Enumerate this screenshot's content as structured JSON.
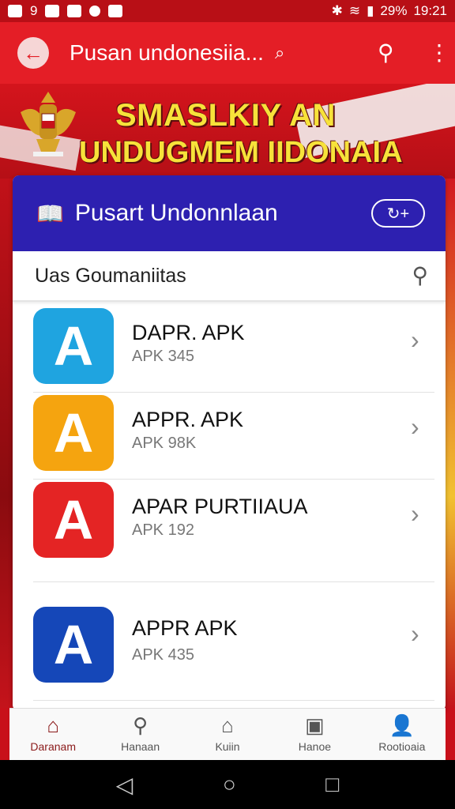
{
  "status_bar": {
    "left_icons": [
      "notification-icon",
      "sim-icon",
      "mail-icon",
      "dot-icon",
      "notification-icon"
    ],
    "left_text": "9",
    "battery": "29%",
    "time": "19:21"
  },
  "appbar": {
    "title": "Pusan undonesiia...",
    "search_glyph": "⌕",
    "back_glyph": "←",
    "search_action_glyph": "⚲",
    "menu_glyph": "⋮"
  },
  "banner": {
    "line1": "SMASLKIY AN",
    "line2": "UNDUGMEM IIDONAIA"
  },
  "card": {
    "title": "Pusart  Undonnlaan",
    "pill": "↻+",
    "book_glyph": "📖",
    "search_text": "Uas Goumaniitas",
    "search_glyph": "⚲"
  },
  "apps": [
    {
      "name": "DAPR. APK",
      "sub": "APK 345",
      "color": "#1fa4e0"
    },
    {
      "name": "APPR. APK",
      "sub": "APK 98K",
      "color": "#f5a40f"
    },
    {
      "name": "APAR PURTIIAUA",
      "sub": "APK 192",
      "color": "#e42424"
    },
    {
      "name": "APPR APK",
      "sub": "APK 435",
      "color": "#1547b8"
    }
  ],
  "partial_app_color": "#1f9a4a",
  "chevron": "›",
  "bottom_nav": [
    {
      "label": "Daranam",
      "icon": "home-icon",
      "glyph": "⌂"
    },
    {
      "label": "Hanaan",
      "icon": "search-icon",
      "glyph": "⚲"
    },
    {
      "label": "Kuiin",
      "icon": "house-icon",
      "glyph": "⌂"
    },
    {
      "label": "Hanoe",
      "icon": "gallery-icon",
      "glyph": "▣"
    },
    {
      "label": "Rootioaia",
      "icon": "user-icon",
      "glyph": "👤"
    }
  ],
  "system_nav": {
    "back": "◁",
    "home": "○",
    "recent": "□"
  }
}
